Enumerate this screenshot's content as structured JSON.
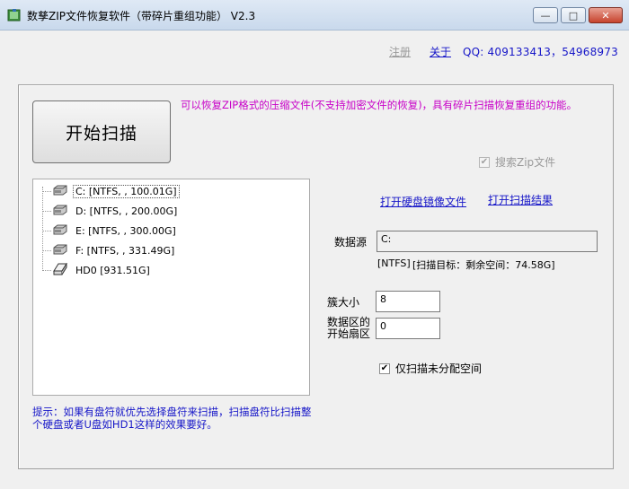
{
  "window": {
    "title": "数孳ZIP文件恢复软件（带碎片重组功能） V2.3",
    "minimize_glyph": "—",
    "maximize_glyph": "□",
    "close_glyph": "✕"
  },
  "header": {
    "register_label": "注册",
    "about_label": "关于",
    "qq_text": "QQ: 409133413，54968973"
  },
  "main": {
    "scan_button_label": "开始扫描",
    "description": "可以恢复ZIP格式的压缩文件(不支持加密文件的恢复)，具有碎片扫描恢复重组的功能。",
    "search_zip_label": "搜索Zip文件",
    "search_zip_checked": true,
    "open_image_link": "打开硬盘镜像文件",
    "open_scan_result_link": "打开扫描结果",
    "data_source_label": "数据源",
    "data_source_value": "C:",
    "fs_info": "[NTFS]",
    "scan_target_info": "[扫描目标：剩余空间：74.58G]",
    "cluster_size_label": "簇大小",
    "cluster_size_value": "8",
    "start_sector_label_1": "数据区的",
    "start_sector_label_2": "开始扇区",
    "start_sector_value": "0",
    "unallocated_only_label": "仅扫描未分配空间",
    "unallocated_only_checked": true,
    "tip": "提示：如果有盘符就优先选择盘符来扫描，扫描盘符比扫描整个硬盘或者U盘如HD1这样的效果要好。"
  },
  "drives": [
    {
      "name": "C:",
      "info": "[NTFS, , 100.01G]",
      "icon": "drive-icon",
      "selected": true
    },
    {
      "name": "D:",
      "info": "[NTFS, , 200.00G]",
      "icon": "drive-icon",
      "selected": false
    },
    {
      "name": "E:",
      "info": "[NTFS, , 300.00G]",
      "icon": "drive-icon",
      "selected": false
    },
    {
      "name": "F:",
      "info": "[NTFS, , 331.49G]",
      "icon": "drive-icon",
      "selected": false
    },
    {
      "name": "HD0",
      "info": "[931.51G]",
      "icon": "harddisk-icon",
      "selected": false
    }
  ],
  "colors": {
    "link": "#1616c8",
    "description": "#c800c8",
    "disabled_text": "#9a9a9a"
  }
}
